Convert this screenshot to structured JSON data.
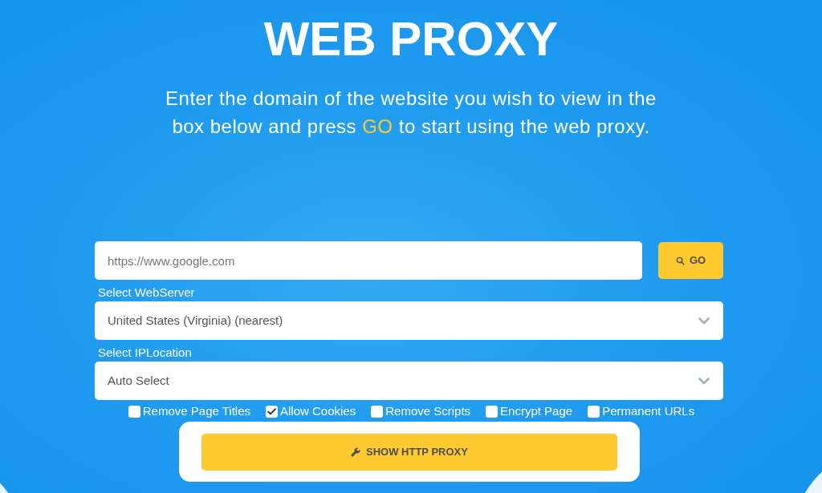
{
  "title": "WEB PROXY",
  "subtitle": [
    {
      "text": "Enter the domain of the website you wish to view in the box below and press ",
      "highlight": false
    },
    {
      "text": "GO",
      "highlight": true
    },
    {
      "text": " to start using the web proxy.",
      "highlight": false
    }
  ],
  "url_field": {
    "placeholder": "https://www.google.com"
  },
  "go_button": {
    "label": "GO"
  },
  "selects": [
    {
      "label": "Select WebServer",
      "value": "United States (Virginia) (nearest)"
    },
    {
      "label": "Select IPLocation",
      "value": "Auto Select"
    }
  ],
  "options": [
    {
      "label": "Remove Page Titles",
      "checked": false
    },
    {
      "label": "Allow Cookies",
      "checked": true
    },
    {
      "label": "Remove Scripts",
      "checked": false
    },
    {
      "label": "Encrypt Page",
      "checked": false
    },
    {
      "label": "Permanent URLs",
      "checked": false
    }
  ],
  "show_proxy_button": {
    "label": "SHOW HTTP PROXY"
  }
}
